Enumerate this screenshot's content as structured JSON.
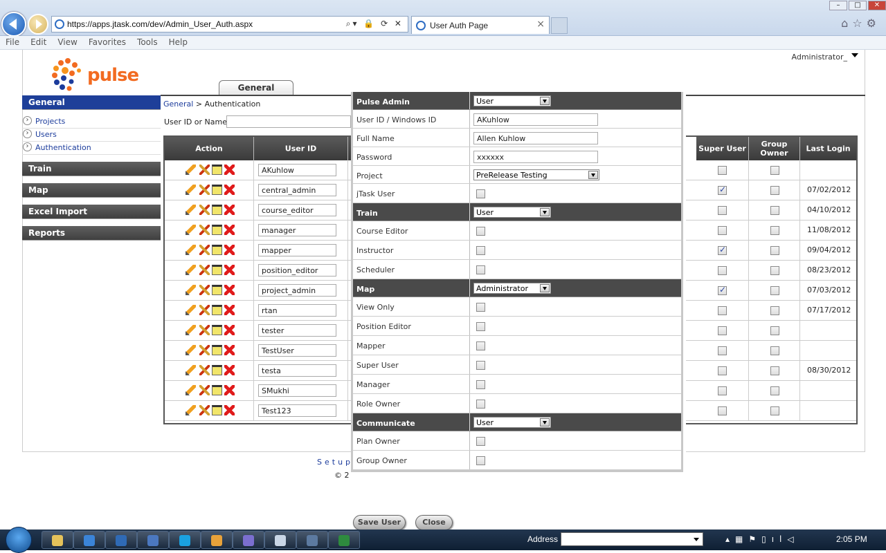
{
  "browser": {
    "url": "https://apps.jtask.com/dev/Admin_User_Auth.aspx",
    "tab_title": "User Auth Page",
    "menu": [
      "File",
      "Edit",
      "View",
      "Favorites",
      "Tools",
      "Help"
    ]
  },
  "header": {
    "logo_text": "pulse",
    "user_menu": "Administrator_",
    "tab": "General"
  },
  "sidebar": {
    "sections": [
      {
        "label": "General",
        "active": true,
        "items": [
          "Projects",
          "Users",
          "Authentication"
        ]
      },
      {
        "label": "Train"
      },
      {
        "label": "Map"
      },
      {
        "label": "Excel Import"
      },
      {
        "label": "Reports"
      }
    ]
  },
  "breadcrumb": {
    "root": "General",
    "sep": ">",
    "current": "Authentication"
  },
  "filter": {
    "label": "User ID or Name",
    "value": ""
  },
  "grid": {
    "columns": [
      "Action",
      "User ID",
      "Super User",
      "Group Owner",
      "Last Login"
    ],
    "rows": [
      {
        "user_id": "AKuhlow",
        "super_user": false,
        "group_owner": false,
        "last_login": ""
      },
      {
        "user_id": "central_admin",
        "super_user": true,
        "group_owner": false,
        "last_login": "07/02/2012"
      },
      {
        "user_id": "course_editor",
        "super_user": false,
        "group_owner": false,
        "last_login": "04/10/2012"
      },
      {
        "user_id": "manager",
        "super_user": false,
        "group_owner": false,
        "last_login": "11/08/2012"
      },
      {
        "user_id": "mapper",
        "super_user": true,
        "group_owner": false,
        "last_login": "09/04/2012"
      },
      {
        "user_id": "position_editor",
        "super_user": false,
        "group_owner": false,
        "last_login": "08/23/2012"
      },
      {
        "user_id": "project_admin",
        "super_user": true,
        "group_owner": false,
        "last_login": "07/03/2012"
      },
      {
        "user_id": "rtan",
        "super_user": false,
        "group_owner": false,
        "last_login": "07/17/2012"
      },
      {
        "user_id": "tester",
        "super_user": false,
        "group_owner": false,
        "last_login": ""
      },
      {
        "user_id": "TestUser",
        "super_user": false,
        "group_owner": false,
        "last_login": ""
      },
      {
        "user_id": "testa",
        "super_user": false,
        "group_owner": false,
        "last_login": "08/30/2012"
      },
      {
        "user_id": "SMukhi",
        "super_user": false,
        "group_owner": false,
        "last_login": ""
      },
      {
        "user_id": "Test123",
        "super_user": false,
        "group_owner": false,
        "last_login": ""
      }
    ]
  },
  "footer": {
    "links": "Setup",
    "copyright": "© 2"
  },
  "modal": {
    "rows": [
      {
        "type": "header",
        "label": "Pulse Admin",
        "select": "User"
      },
      {
        "type": "text",
        "label": "User ID / Windows ID",
        "value": "AKuhlow"
      },
      {
        "type": "text",
        "label": "Full Name",
        "value": "Allen Kuhlow"
      },
      {
        "type": "text",
        "label": "Password",
        "value": "xxxxxx"
      },
      {
        "type": "select",
        "label": "Project",
        "select": "PreRelease Testing"
      },
      {
        "type": "check",
        "label": "jTask User",
        "checked": false
      },
      {
        "type": "header",
        "label": "Train",
        "select": "User"
      },
      {
        "type": "check",
        "label": "Course Editor",
        "checked": false
      },
      {
        "type": "check",
        "label": "Instructor",
        "checked": false
      },
      {
        "type": "check",
        "label": "Scheduler",
        "checked": false
      },
      {
        "type": "header",
        "label": "Map",
        "select": "Administrator"
      },
      {
        "type": "check",
        "label": "View Only",
        "checked": false
      },
      {
        "type": "check",
        "label": "Position Editor",
        "checked": false
      },
      {
        "type": "check",
        "label": "Mapper",
        "checked": false
      },
      {
        "type": "check",
        "label": "Super User",
        "checked": false
      },
      {
        "type": "check",
        "label": "Manager",
        "checked": false
      },
      {
        "type": "check",
        "label": "Role Owner",
        "checked": false
      },
      {
        "type": "header",
        "label": "Communicate",
        "select": "User"
      },
      {
        "type": "check",
        "label": "Plan Owner",
        "checked": false
      },
      {
        "type": "check",
        "label": "Group Owner",
        "checked": false
      }
    ],
    "save_label": "Save User",
    "close_label": "Close"
  },
  "taskbar": {
    "address_label": "Address",
    "address_value": "",
    "clock": "2:05 PM",
    "apps": [
      "explorer",
      "ie",
      "lync",
      "excel-tool",
      "skype",
      "outlook",
      "app",
      "notepad",
      "tool",
      "excel"
    ]
  }
}
